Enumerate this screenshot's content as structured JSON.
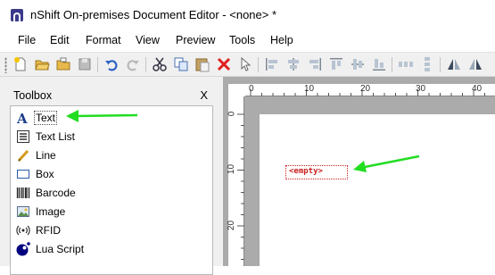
{
  "window": {
    "title": "nShift On-premises Document Editor - <none> *"
  },
  "menu": {
    "items": [
      "File",
      "Edit",
      "Format",
      "View",
      "Preview",
      "Tools",
      "Help"
    ]
  },
  "toolbar": {
    "buttons": [
      "new-icon",
      "open-icon",
      "open-folder-icon",
      "save-icon",
      "undo-icon",
      "redo-icon",
      "cut-icon",
      "copy-icon",
      "paste-icon",
      "delete-icon",
      "pointer-icon",
      "align-left-icon",
      "align-center-icon",
      "align-right-icon",
      "align-top-icon",
      "align-middle-icon",
      "align-bottom-icon",
      "space-horizontal-icon",
      "space-vertical-icon",
      "flip-icon",
      "mirror-icon"
    ]
  },
  "toolbox": {
    "title": "Toolbox",
    "close": "X",
    "items": [
      {
        "label": "Text",
        "icon": "text-icon"
      },
      {
        "label": "Text List",
        "icon": "text-list-icon"
      },
      {
        "label": "Line",
        "icon": "line-icon"
      },
      {
        "label": "Box",
        "icon": "box-icon"
      },
      {
        "label": "Barcode",
        "icon": "barcode-icon"
      },
      {
        "label": "Image",
        "icon": "image-icon"
      },
      {
        "label": "RFID",
        "icon": "rfid-icon"
      },
      {
        "label": "Lua Script",
        "icon": "lua-script-icon"
      }
    ]
  },
  "ruler": {
    "top": [
      "0",
      "10",
      "20",
      "30",
      "40"
    ],
    "left": [
      "0",
      "10",
      "20"
    ]
  },
  "canvas": {
    "element_text": "<empty>"
  },
  "colors": {
    "annotation_arrow": "#22dd22",
    "empty_text": "#c81e1e",
    "app_icon": "#3a3a8c"
  }
}
